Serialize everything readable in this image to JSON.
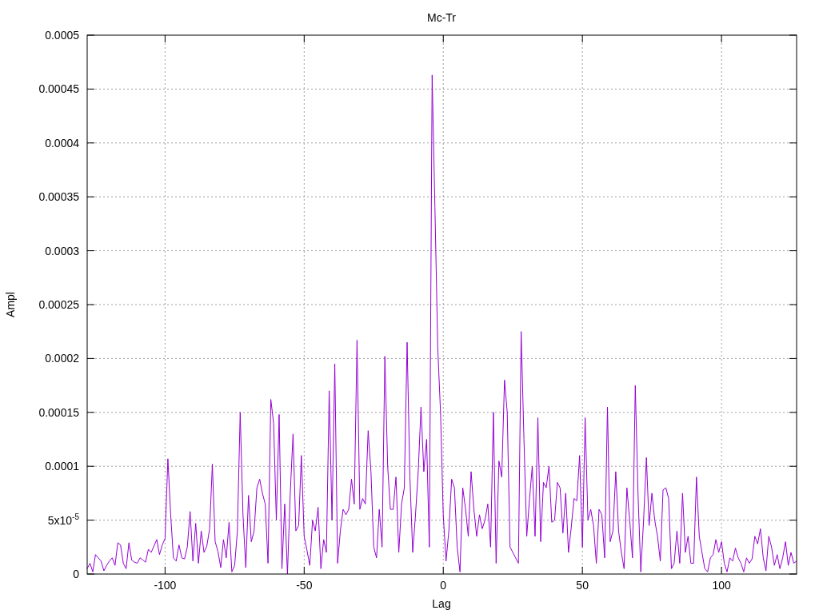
{
  "plot": {
    "chart_data": {
      "type": "line",
      "title": "Mc-Tr",
      "xlabel": "Lag",
      "ylabel": "Ampl",
      "grid": true,
      "xlim": [
        -128,
        127
      ],
      "ylim": [
        0,
        0.0005
      ],
      "xticks": [
        -100,
        -50,
        0,
        50,
        100
      ],
      "yticks": [
        0,
        {
          "value": 5e-05,
          "label": "5x10$^{-5}$"
        },
        0.0001,
        0.00015,
        0.0002,
        0.00025,
        0.0003,
        0.00035,
        0.0004,
        0.00045,
        0.0005
      ],
      "x": [
        -128,
        -127,
        -126,
        -125,
        -124,
        -123,
        -122,
        -121,
        -120,
        -119,
        -118,
        -117,
        -116,
        -115,
        -114,
        -113,
        -112,
        -111,
        -110,
        -109,
        -108,
        -107,
        -106,
        -105,
        -104,
        -103,
        -102,
        -101,
        -100,
        -99,
        -98,
        -97,
        -96,
        -95,
        -94,
        -93,
        -92,
        -91,
        -90,
        -89,
        -88,
        -87,
        -86,
        -85,
        -84,
        -83,
        -82,
        -81,
        -80,
        -79,
        -78,
        -77,
        -76,
        -75,
        -74,
        -73,
        -72,
        -71,
        -70,
        -69,
        -68,
        -67,
        -66,
        -65,
        -64,
        -63,
        -62,
        -61,
        -60,
        -59,
        -58,
        -57,
        -56,
        -55,
        -54,
        -53,
        -52,
        -51,
        -50,
        -49,
        -48,
        -47,
        -46,
        -45,
        -44,
        -43,
        -42,
        -41,
        -40,
        -39,
        -38,
        -37,
        -36,
        -35,
        -34,
        -33,
        -32,
        -31,
        -30,
        -29,
        -28,
        -27,
        -26,
        -25,
        -24,
        -23,
        -22,
        -21,
        -20,
        -19,
        -18,
        -17,
        -16,
        -15,
        -14,
        -13,
        -12,
        -11,
        -10,
        -9,
        -8,
        -7,
        -6,
        -5,
        -4,
        -3,
        -2,
        -1,
        0,
        1,
        2,
        3,
        4,
        5,
        6,
        7,
        8,
        9,
        10,
        11,
        12,
        13,
        14,
        15,
        16,
        17,
        18,
        19,
        20,
        21,
        22,
        23,
        24,
        25,
        26,
        27,
        28,
        29,
        30,
        31,
        32,
        33,
        34,
        35,
        36,
        37,
        38,
        39,
        40,
        41,
        42,
        43,
        44,
        45,
        46,
        47,
        48,
        49,
        50,
        51,
        52,
        53,
        54,
        55,
        56,
        57,
        58,
        59,
        60,
        61,
        62,
        63,
        64,
        65,
        66,
        67,
        68,
        69,
        70,
        71,
        72,
        73,
        74,
        75,
        76,
        77,
        78,
        79,
        80,
        81,
        82,
        83,
        84,
        85,
        86,
        87,
        88,
        89,
        90,
        91,
        92,
        93,
        94,
        95,
        96,
        97,
        98,
        99,
        100,
        101,
        102,
        103,
        104,
        105,
        106,
        107,
        108,
        109,
        110,
        111,
        112,
        113,
        114,
        115,
        116,
        117,
        118,
        119,
        120,
        121,
        122,
        123,
        124,
        125,
        126,
        127
      ],
      "series": [
        {
          "color": "#9400d3",
          "values": [
            5e-06,
            1e-05,
            2e-06,
            1.8e-05,
            1.5e-05,
            1.2e-05,
            3e-06,
            8e-06,
            1.2e-05,
            1.5e-05,
            8e-06,
            2.9e-05,
            2.7e-05,
            1e-05,
            5e-06,
            2.9e-05,
            1.3e-05,
            1.1e-05,
            1e-05,
            1.5e-05,
            1.3e-05,
            1.1e-05,
            2.3e-05,
            2e-05,
            2.6e-05,
            3.2e-05,
            1.8e-05,
            2.7e-05,
            3.3e-05,
            0.000107,
            5.5e-05,
            1.5e-05,
            1.2e-05,
            2.7e-05,
            1.5e-05,
            1.4e-05,
            2.5e-05,
            5.8e-05,
            1.2e-05,
            4.7e-05,
            1e-05,
            4e-05,
            2e-05,
            2.6e-05,
            4.2e-05,
            0.000102,
            3e-05,
            2.1e-05,
            6e-06,
            3.2e-05,
            1.5e-05,
            4.8e-05,
            2e-06,
            8e-06,
            4e-05,
            0.00015,
            5.5e-05,
            6e-06,
            7.3e-05,
            3e-05,
            4e-05,
            8e-05,
            8.8e-05,
            7.5e-05,
            6.5e-05,
            1e-05,
            0.000162,
            0.00014,
            5e-05,
            0.000148,
            5e-06,
            6.5e-05,
            0,
            7.5e-05,
            0.00013,
            4e-05,
            4.5e-05,
            0.00011,
            3.5e-05,
            2.2e-05,
            8e-06,
            5e-05,
            4e-05,
            6.2e-05,
            5e-06,
            3.2e-05,
            2e-05,
            0.00017,
            5e-05,
            0.000195,
            1e-05,
            4e-05,
            6e-05,
            5.5e-05,
            6e-05,
            8.8e-05,
            6.5e-05,
            0.000217,
            6e-05,
            7e-05,
            6.5e-05,
            0.000133,
            9.5e-05,
            2.5e-05,
            1.5e-05,
            6e-05,
            2.5e-05,
            0.000202,
            0.0001,
            6e-05,
            6e-05,
            9e-05,
            2e-05,
            6.5e-05,
            8e-05,
            0.000215,
            9e-05,
            2e-05,
            5.5e-05,
            9.5e-05,
            0.000155,
            9.5e-05,
            0.000125,
            2.5e-05,
            0.000463,
            0.00034,
            0.00021,
            0.00015,
            5.5e-05,
            1.2e-05,
            4e-05,
            8.8e-05,
            8e-05,
            2.5e-05,
            2e-06,
            8e-05,
            6e-05,
            3.5e-05,
            9.5e-05,
            6e-05,
            3.5e-05,
            5.5e-05,
            4.2e-05,
            5e-05,
            6.5e-05,
            2.5e-05,
            0.00015,
            1e-05,
            0.000105,
            9e-05,
            0.00018,
            0.00015,
            2.5e-05,
            2e-05,
            1.5e-05,
            1e-05,
            0.000225,
            0.000125,
            3.5e-05,
            7e-05,
            0.0001,
            3.5e-05,
            0.000145,
            3e-05,
            8.5e-05,
            8e-05,
            0.0001,
            4.8e-05,
            5e-05,
            8.5e-05,
            8e-05,
            3.8e-05,
            7.5e-05,
            2e-05,
            4.3e-05,
            7e-05,
            6.8e-05,
            0.00011,
            2.5e-05,
            0.000145,
            5e-05,
            6e-05,
            4.5e-05,
            1e-05,
            6e-05,
            5.5e-05,
            1.5e-05,
            0.000155,
            3e-05,
            4e-05,
            9.5e-05,
            4e-05,
            2e-05,
            5e-06,
            8e-05,
            5e-05,
            1.5e-05,
            0.000175,
            7.5e-05,
            2e-06,
            5e-05,
            0.000108,
            4.5e-05,
            7.5e-05,
            5e-05,
            3.5e-05,
            1.2e-05,
            7.8e-05,
            8e-05,
            7e-05,
            5e-06,
            1e-05,
            4e-05,
            1e-05,
            7.5e-05,
            2e-05,
            3.5e-05,
            1e-05,
            1e-05,
            9e-05,
            3.5e-05,
            2e-05,
            5e-06,
            2e-06,
            1.5e-05,
            1.8e-05,
            3.2e-05,
            2e-05,
            3e-05,
            1e-05,
            2e-06,
            1.5e-05,
            1.2e-05,
            2.4e-05,
            1.5e-05,
            1e-05,
            2e-06,
            1.5e-05,
            1e-05,
            1.4e-05,
            3.5e-05,
            2.8e-05,
            4.2e-05,
            1.5e-05,
            3e-06,
            3.5e-05,
            2.5e-05,
            8e-06,
            1.8e-05,
            5e-06,
            1.5e-05,
            3e-05,
            8e-06,
            2e-05,
            1e-05,
            1.2e-05
          ]
        }
      ]
    }
  }
}
